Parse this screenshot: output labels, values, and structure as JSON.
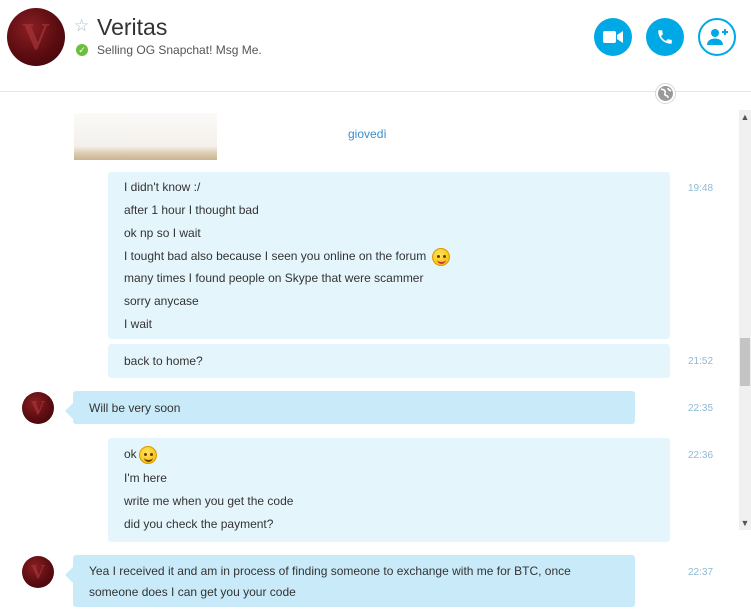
{
  "header": {
    "contact_name": "Veritas",
    "mood_message": "Selling OG Snapchat! Msg Me.",
    "status": "online",
    "favorite_icon": "star-outline-icon",
    "buttons": {
      "video_call": "video-camera-icon",
      "audio_call": "phone-icon",
      "add_people": "add-person-icon"
    }
  },
  "conversation": {
    "day_separator": "giovedì",
    "messages": [
      {
        "direction": "outgoing",
        "time": "19:48",
        "lines": [
          "I didn't know :/",
          "after 1 hour I thought bad",
          "ok np so I wait",
          "I tought bad also because I seen you online on the forum",
          "many times I found people on Skype that were scammer",
          "sorry anycase",
          "I wait"
        ]
      },
      {
        "direction": "outgoing",
        "time": "21:52",
        "lines": [
          "back to home?"
        ]
      },
      {
        "direction": "incoming",
        "time": "22:35",
        "lines": [
          "Will be very soon"
        ]
      },
      {
        "direction": "outgoing",
        "time": "22:36",
        "lines": [
          "ok",
          "I'm here",
          "write me when you get the code",
          "did you check the payment?"
        ]
      },
      {
        "direction": "incoming",
        "time": "22:37",
        "lines": [
          "Yea I received it and am in process of finding someone to exchange with me for BTC, once",
          "someone does I can get you your code"
        ]
      }
    ]
  },
  "colors": {
    "accent": "#00a8e6",
    "outgoing_bubble": "#e5f5fc",
    "incoming_bubble": "#c9ebf9",
    "online": "#6bbf3a",
    "timestamp": "#8fb9d3"
  }
}
